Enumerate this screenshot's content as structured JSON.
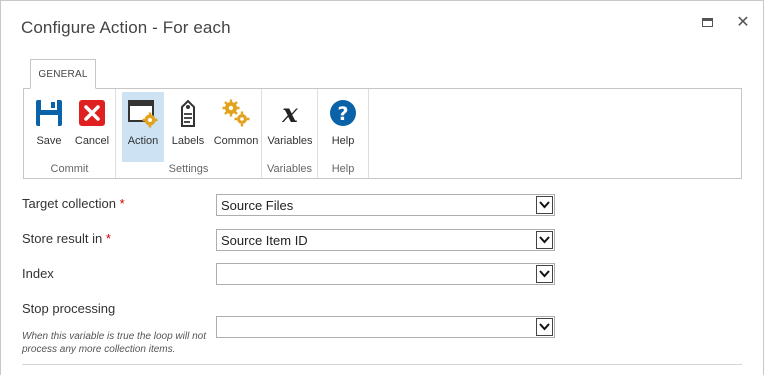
{
  "dialog": {
    "title": "Configure Action - For each",
    "close_glyph": "✕"
  },
  "ribbon": {
    "tab": "GENERAL",
    "groups": [
      {
        "label": "Commit",
        "buttons": [
          {
            "label": "Save",
            "icon": "save-icon"
          },
          {
            "label": "Cancel",
            "icon": "cancel-icon"
          }
        ]
      },
      {
        "label": "Settings",
        "buttons": [
          {
            "label": "Action",
            "icon": "action-icon",
            "selected": true
          },
          {
            "label": "Labels",
            "icon": "labels-icon"
          },
          {
            "label": "Common",
            "icon": "gears-icon"
          }
        ]
      },
      {
        "label": "Variables",
        "buttons": [
          {
            "label": "Variables",
            "icon": "variable-x-icon"
          }
        ]
      },
      {
        "label": "Help",
        "buttons": [
          {
            "label": "Help",
            "icon": "help-icon"
          }
        ]
      }
    ]
  },
  "form": {
    "target_collection": {
      "label": "Target collection",
      "required": "*",
      "value": "Source Files"
    },
    "store_result": {
      "label": "Store result in",
      "required": "*",
      "value": "Source Item ID"
    },
    "index": {
      "label": "Index",
      "value": ""
    },
    "stop_processing": {
      "label": "Stop processing",
      "help": "When this variable is true the loop will not process any more collection items.",
      "value": ""
    }
  },
  "colors": {
    "accent_blue": "#0a62a8",
    "cancel_red": "#e02020",
    "gear_orange": "#e2a21c",
    "selected_bg": "#cde2f3"
  }
}
